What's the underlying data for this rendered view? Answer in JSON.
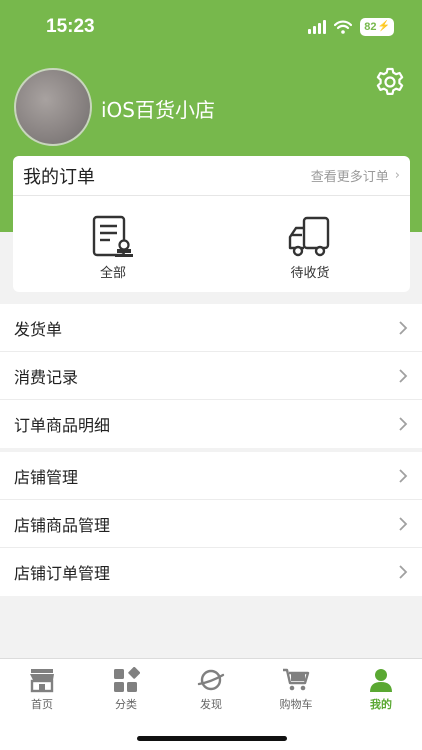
{
  "status_bar": {
    "time": "15:23",
    "battery": "82"
  },
  "profile": {
    "store_name": "iOS百货小店"
  },
  "orders": {
    "title": "我的订单",
    "more_label": "查看更多订单",
    "shortcuts": [
      {
        "label": "全部",
        "icon": "order-list-icon"
      },
      {
        "label": "待收货",
        "icon": "delivery-truck-icon"
      }
    ]
  },
  "menu_group_1": [
    {
      "label": "发货单"
    },
    {
      "label": "消费记录"
    },
    {
      "label": "订单商品明细"
    }
  ],
  "menu_group_2": [
    {
      "label": "店铺管理"
    },
    {
      "label": "店铺商品管理"
    },
    {
      "label": "店铺订单管理"
    }
  ],
  "tabbar": {
    "items": [
      {
        "label": "首页",
        "icon": "store-icon"
      },
      {
        "label": "分类",
        "icon": "category-icon"
      },
      {
        "label": "发现",
        "icon": "planet-icon"
      },
      {
        "label": "购物车",
        "icon": "cart-icon"
      },
      {
        "label": "我的",
        "icon": "person-icon"
      }
    ],
    "active_index": 4
  },
  "colors": {
    "brand": "#77b84c",
    "active_tab": "#5aa832"
  }
}
